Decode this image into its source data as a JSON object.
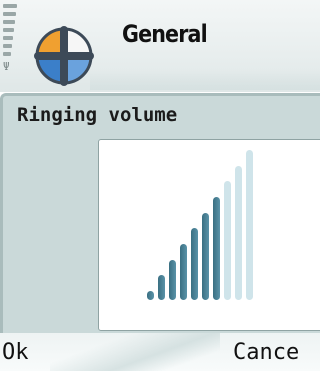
{
  "title_pane": {
    "app_title": "General",
    "app_icon": "general-profile-icon",
    "signal_icon": "signal-strength-icon",
    "antenna_icon": "antenna-icon"
  },
  "dialog": {
    "heading": "Ringing volume",
    "volume_level": 7,
    "volume_max": 10
  },
  "softkeys": {
    "left_label": "Ok",
    "right_label": "Cance"
  },
  "colors": {
    "bar_active": "#3a6f82",
    "bar_inactive": "#cfe4ea",
    "dialog_bg": "#cad9d9"
  }
}
